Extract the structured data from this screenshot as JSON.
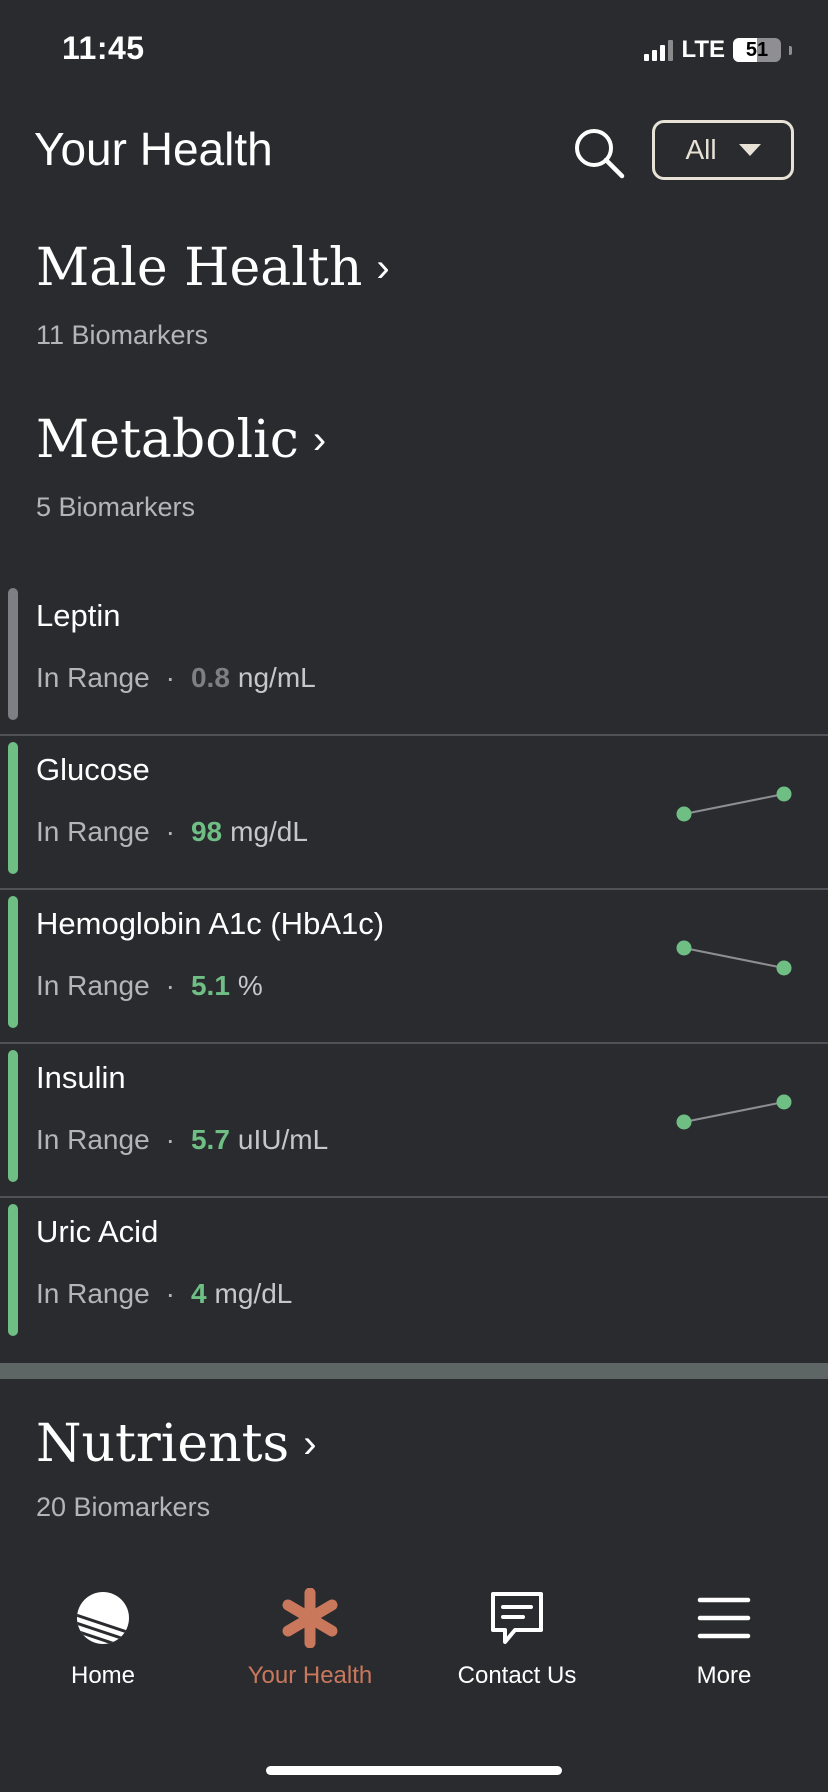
{
  "status_bar": {
    "time": "11:45",
    "network": "LTE",
    "battery": "51",
    "battery_level": 0.51
  },
  "header": {
    "title": "Your Health",
    "filter_label": "All"
  },
  "sections": [
    {
      "title": "Male Health",
      "subtitle": "11 Biomarkers"
    },
    {
      "title": "Metabolic",
      "subtitle": "5 Biomarkers"
    },
    {
      "title": "Nutrients",
      "subtitle": "20 Biomarkers"
    }
  ],
  "biomarkers": [
    {
      "name": "Leptin",
      "status": "In Range",
      "value": "0.8",
      "unit": "ng/mL",
      "color": "#7e7f84",
      "trend": []
    },
    {
      "name": "Glucose",
      "status": "In Range",
      "value": "98",
      "unit": "mg/dL",
      "color": "#6fbf85",
      "trend": [
        "low",
        "high"
      ]
    },
    {
      "name": "Hemoglobin A1c (HbA1c)",
      "status": "In Range",
      "value": "5.1",
      "unit": "%",
      "color": "#6fbf85",
      "trend": [
        "high",
        "low"
      ]
    },
    {
      "name": "Insulin",
      "status": "In Range",
      "value": "5.7",
      "unit": "uIU/mL",
      "color": "#6fbf85",
      "trend": [
        "low",
        "high"
      ]
    },
    {
      "name": "Uric Acid",
      "status": "In Range",
      "value": "4",
      "unit": "mg/dL",
      "color": "#6fbf85",
      "trend": []
    }
  ],
  "colors": {
    "accent": "#c9785c",
    "in_range": "#6fbf85",
    "neutral": "#7e7f84",
    "background": "#2a2b2f"
  },
  "tab_bar": {
    "tabs": [
      {
        "label": "Home",
        "icon": "home-icon"
      },
      {
        "label": "Your Health",
        "icon": "asterisk-icon",
        "active": true
      },
      {
        "label": "Contact Us",
        "icon": "chat-icon"
      },
      {
        "label": "More",
        "icon": "menu-icon"
      }
    ]
  }
}
